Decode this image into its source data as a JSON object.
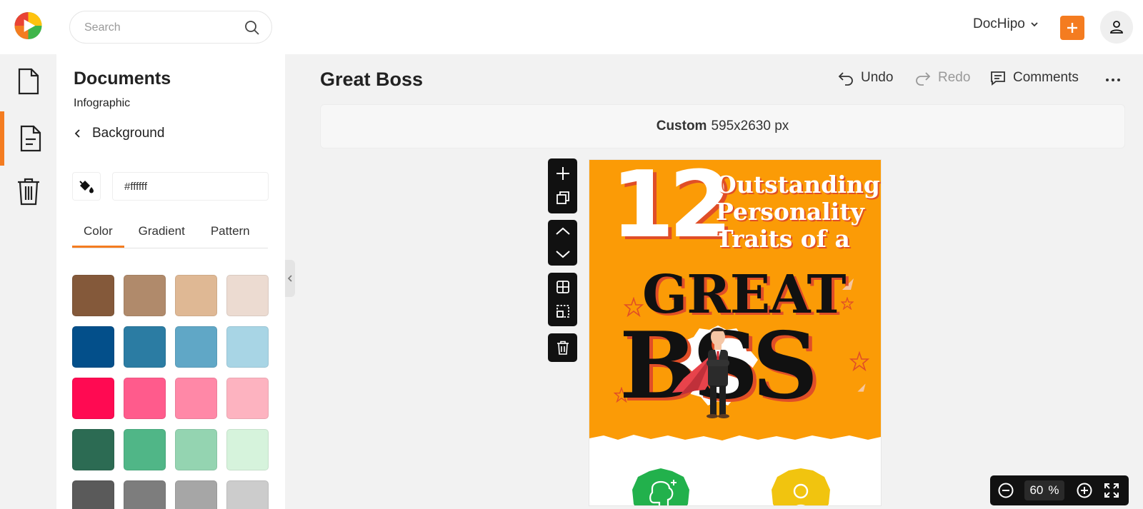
{
  "header": {
    "search_placeholder": "Search",
    "account_name": "DocHipo",
    "brand_color": "#f47c20"
  },
  "rail": {
    "items": [
      {
        "icon": "page-icon",
        "active": false
      },
      {
        "icon": "document-icon",
        "active": true
      },
      {
        "icon": "trash-icon",
        "active": false
      }
    ]
  },
  "panel": {
    "title": "Documents",
    "subtitle": "Infographic",
    "back_label": "Background",
    "hex_value": "#ffffff",
    "tabs": [
      "Color",
      "Gradient",
      "Pattern"
    ],
    "active_tab": "Color",
    "swatches": [
      "#84593a",
      "#b08a6b",
      "#dfb894",
      "#ecdbd1",
      "#034f8a",
      "#2b7ca3",
      "#60a7c6",
      "#a8d5e5",
      "#ff0a52",
      "#ff5b8c",
      "#ff88a7",
      "#fdb3c0",
      "#2c6b53",
      "#50b687",
      "#94d4b1",
      "#d6f3dc",
      "#5a5a5a",
      "#7d7d7d",
      "#a6a6a6",
      "#cccccc"
    ]
  },
  "main": {
    "doc_title": "Great Boss",
    "undo_label": "Undo",
    "redo_label": "Redo",
    "comments_label": "Comments",
    "size_kind": "Custom",
    "size_value": "595x2630 px"
  },
  "canvas": {
    "number": "12",
    "headline_lines": [
      "Outstanding",
      "Personality",
      "Traits of a"
    ],
    "word1": "GREAT",
    "word2": "BSS",
    "accent": "#fb9b06"
  },
  "zoom": {
    "value": "60",
    "unit": "%"
  }
}
